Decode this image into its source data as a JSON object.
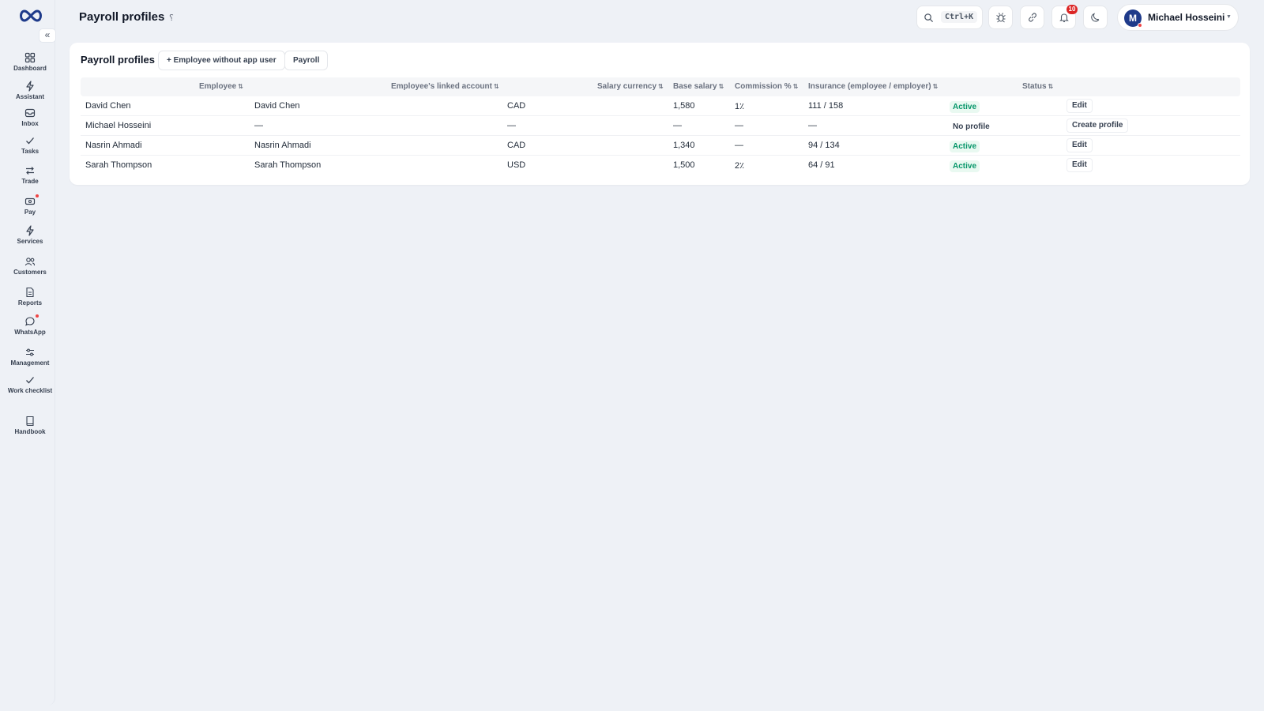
{
  "header": {
    "title": "Payroll profiles",
    "search_shortcut": "Ctrl+K",
    "notification_count": "10",
    "user": {
      "initial": "M",
      "name": "Michael Hosseini"
    }
  },
  "sidebar": {
    "collapse_label": "«",
    "items": [
      {
        "label": "Dashboard",
        "icon": "dashboard-icon"
      },
      {
        "label": "Assistant",
        "icon": "bolt-icon"
      },
      {
        "label": "Inbox",
        "icon": "inbox-icon"
      },
      {
        "label": "Tasks",
        "icon": "check-icon"
      },
      {
        "label": "Trade",
        "icon": "swap-icon"
      },
      {
        "label": "Pay",
        "icon": "wallet-icon"
      },
      {
        "label": "Services",
        "icon": "bolt-icon"
      },
      {
        "label": "Customers",
        "icon": "users-icon"
      },
      {
        "label": "Reports",
        "icon": "file-icon"
      },
      {
        "label": "WhatsApp",
        "icon": "chat-icon"
      },
      {
        "label": "Management",
        "icon": "sliders-icon"
      },
      {
        "label": "Work checklist",
        "icon": "check-icon"
      },
      {
        "label": "Handbook",
        "icon": "book-icon"
      }
    ]
  },
  "card": {
    "title": "Payroll profiles",
    "add_button": "+ Employee without app user",
    "payroll_button": "Payroll",
    "columns": {
      "employee": "Employee",
      "linked_account": "Employee's linked account",
      "currency": "Salary currency",
      "base_salary": "Base salary",
      "commission": "Commission %",
      "insurance": "Insurance (employee / employer)",
      "status": "Status"
    },
    "sort_glyph": "⇅",
    "rows": [
      {
        "employee": "David Chen",
        "linked": "David Chen",
        "currency": "CAD",
        "salary": "1,580",
        "commission": "1٪",
        "insurance": "111 / 158",
        "status": "Active",
        "action": "Edit"
      },
      {
        "employee": "Michael Hosseini",
        "linked": "—",
        "currency": "—",
        "salary": "—",
        "commission": "—",
        "insurance": "—",
        "status": "No profile",
        "action": "Create profile"
      },
      {
        "employee": "Nasrin Ahmadi",
        "linked": "Nasrin Ahmadi",
        "currency": "CAD",
        "salary": "1,340",
        "commission": "—",
        "insurance": "94 / 134",
        "status": "Active",
        "action": "Edit"
      },
      {
        "employee": "Sarah Thompson",
        "linked": "Sarah Thompson",
        "currency": "USD",
        "salary": "1,500",
        "commission": "2٪",
        "insurance": "64 / 91",
        "status": "Active",
        "action": "Edit"
      }
    ]
  },
  "colors": {
    "accent": "#1e3a8a",
    "active": "#059669",
    "badge": "#dc2626"
  }
}
